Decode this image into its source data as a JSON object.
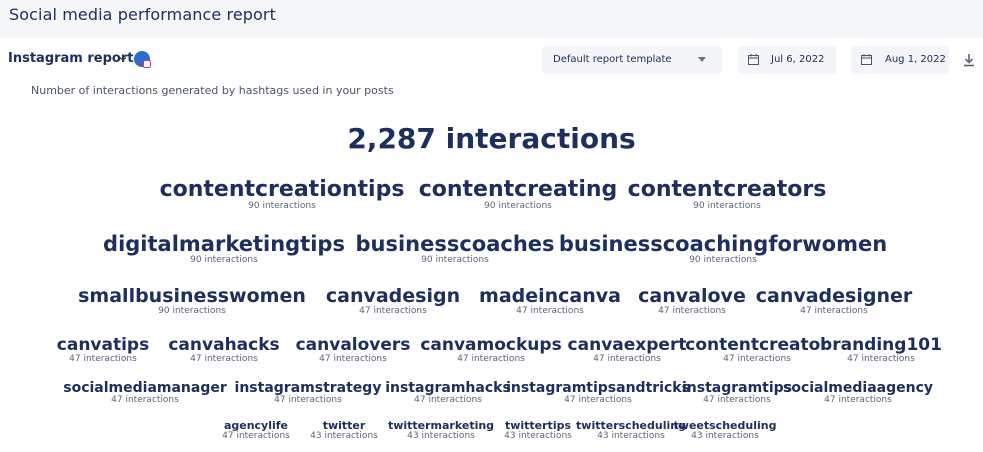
{
  "header": {
    "title": "Social media performance report"
  },
  "report": {
    "title": "Instagram report"
  },
  "template": {
    "label": "Default report template"
  },
  "dates": {
    "start": "Jul 6, 2022",
    "end": "Aug 1, 2022"
  },
  "subtitle": "Number of interactions generated by hashtags used in your posts",
  "total": "2,287 interactions",
  "hashtags": [
    {
      "tag": "contentcreationtips",
      "count": "90 interactions"
    },
    {
      "tag": "contentcreating",
      "count": "90 interactions"
    },
    {
      "tag": "contentcreators",
      "count": "90 interactions"
    },
    {
      "tag": "digitalmarketingtips",
      "count": "90 interactions"
    },
    {
      "tag": "businesscoaches",
      "count": "90 interactions"
    },
    {
      "tag": "businesscoachingforwomen",
      "count": "90 interactions"
    },
    {
      "tag": "smallbusinesswomen",
      "count": "90 interactions"
    },
    {
      "tag": "canvadesign",
      "count": "47 interactions"
    },
    {
      "tag": "madeincanva",
      "count": "47 interactions"
    },
    {
      "tag": "canvalove",
      "count": "47 interactions"
    },
    {
      "tag": "canvadesigner",
      "count": "47 interactions"
    },
    {
      "tag": "canvatips",
      "count": "47 interactions"
    },
    {
      "tag": "canvahacks",
      "count": "47 interactions"
    },
    {
      "tag": "canvalovers",
      "count": "47 interactions"
    },
    {
      "tag": "canvamockups",
      "count": "47 interactions"
    },
    {
      "tag": "canvaexpert",
      "count": "47 interactions"
    },
    {
      "tag": "contentcreator",
      "count": "47 interactions"
    },
    {
      "tag": "branding101",
      "count": "47 interactions"
    },
    {
      "tag": "socialmediamanager",
      "count": "47 interactions"
    },
    {
      "tag": "instagramstrategy",
      "count": "47 interactions"
    },
    {
      "tag": "instagramhacks",
      "count": "47 interactions"
    },
    {
      "tag": "instagramtipsandtricks",
      "count": "47 interactions"
    },
    {
      "tag": "instagramtips",
      "count": "47 interactions"
    },
    {
      "tag": "socialmediaagency",
      "count": "47 interactions"
    },
    {
      "tag": "agencylife",
      "count": "47 interactions"
    },
    {
      "tag": "twitter",
      "count": "43 interactions"
    },
    {
      "tag": "twittermarketing",
      "count": "43 interactions"
    },
    {
      "tag": "twittertips",
      "count": "43 interactions"
    },
    {
      "tag": "twitterscheduling",
      "count": "43 interactions"
    },
    {
      "tag": "tweetscheduling",
      "count": "43 interactions"
    }
  ]
}
